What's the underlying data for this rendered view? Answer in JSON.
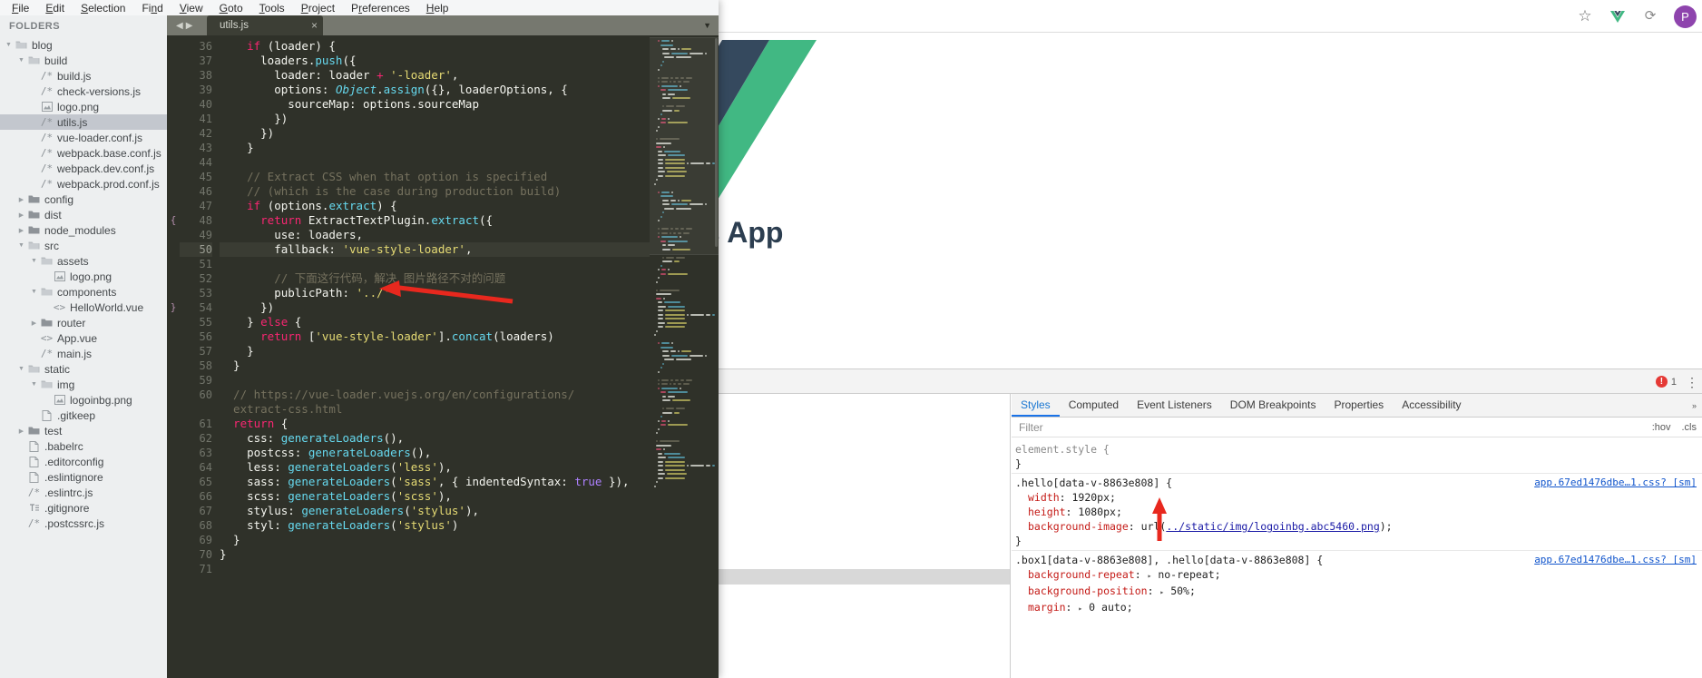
{
  "colors": {
    "accent_blue": "#1a73e8",
    "vue_green": "#41b883",
    "vue_dark": "#35495e",
    "error_red": "#e53935",
    "annotation_red": "#e8281e",
    "editor_bg": "#2f3129",
    "sidebar_bg": "#edeff0",
    "selection_bg": "#c3c7ce"
  },
  "browser": {
    "toolbar_icons": [
      {
        "name": "bookmark-star-icon",
        "glyph": "☆"
      },
      {
        "name": "vue-devtools-icon",
        "glyph": "V"
      },
      {
        "name": "extensions-icon",
        "glyph": "⟳"
      }
    ],
    "profile_initial": "P"
  },
  "webpage": {
    "hero_title": "our Vue.js App"
  },
  "devtools": {
    "error_count": "1",
    "kebab": "⋮",
    "tabs": [
      {
        "label": "Styles",
        "active": true
      },
      {
        "label": "Computed",
        "active": false
      },
      {
        "label": "Event Listeners",
        "active": false
      },
      {
        "label": "DOM Breakpoints",
        "active": false
      },
      {
        "label": "Properties",
        "active": false
      },
      {
        "label": "Accessibility",
        "active": false
      }
    ],
    "overflow_chevron": "»",
    "filter": {
      "value": "",
      "placeholder": "Filter"
    },
    "filter_options": [
      ":hov",
      ".cls"
    ],
    "css_rules": [
      {
        "selector": "element.style {",
        "origin": "",
        "declarations": [],
        "close": "}"
      },
      {
        "selector": ".hello[data-v-8863e808] {",
        "origin": "app.67ed1476dbe…1.css? [sm]",
        "declarations": [
          {
            "prop": "width",
            "value": "1920px;",
            "kind": "plain"
          },
          {
            "prop": "height",
            "value": "1080px;",
            "kind": "plain"
          },
          {
            "prop": "background-image",
            "value": "url(",
            "url": "../static/img/logoinbg.abc5460.png",
            "value_end": ");",
            "kind": "url"
          }
        ],
        "close": "}"
      },
      {
        "selector": ".box1[data-v-8863e808], .hello[data-v-8863e808] {",
        "origin": "app.67ed1476dbe…1.css? [sm]",
        "declarations": [
          {
            "prop": "background-repeat",
            "value": "no-repeat;",
            "kind": "tri"
          },
          {
            "prop": "background-position",
            "value": "50%;",
            "kind": "tri"
          },
          {
            "prop": "margin",
            "value": "0 auto;",
            "kind": "tri"
          }
        ],
        "close": ""
      }
    ]
  },
  "sublime": {
    "menu": [
      {
        "label": "File",
        "mnemonic": "F"
      },
      {
        "label": "Edit",
        "mnemonic": "E"
      },
      {
        "label": "Selection",
        "mnemonic": "S"
      },
      {
        "label": "Find",
        "mnemonic": "n"
      },
      {
        "label": "View",
        "mnemonic": "V"
      },
      {
        "label": "Goto",
        "mnemonic": "G"
      },
      {
        "label": "Tools",
        "mnemonic": "T"
      },
      {
        "label": "Project",
        "mnemonic": "P"
      },
      {
        "label": "Preferences",
        "mnemonic": "r"
      },
      {
        "label": "Help",
        "mnemonic": "H"
      }
    ],
    "sidebar_title": "FOLDERS",
    "tree": [
      {
        "label": "blog",
        "depth": 0,
        "type": "folder-open",
        "arrow": "open",
        "selected": false
      },
      {
        "label": "build",
        "depth": 1,
        "type": "folder-open",
        "arrow": "open",
        "selected": false
      },
      {
        "label": "build.js",
        "depth": 2,
        "type": "js",
        "arrow": "none",
        "selected": false
      },
      {
        "label": "check-versions.js",
        "depth": 2,
        "type": "js",
        "arrow": "none",
        "selected": false
      },
      {
        "label": "logo.png",
        "depth": 2,
        "type": "image",
        "arrow": "none",
        "selected": false
      },
      {
        "label": "utils.js",
        "depth": 2,
        "type": "js",
        "arrow": "none",
        "selected": true
      },
      {
        "label": "vue-loader.conf.js",
        "depth": 2,
        "type": "js",
        "arrow": "none",
        "selected": false
      },
      {
        "label": "webpack.base.conf.js",
        "depth": 2,
        "type": "js",
        "arrow": "none",
        "selected": false
      },
      {
        "label": "webpack.dev.conf.js",
        "depth": 2,
        "type": "js",
        "arrow": "none",
        "selected": false
      },
      {
        "label": "webpack.prod.conf.js",
        "depth": 2,
        "type": "js",
        "arrow": "none",
        "selected": false
      },
      {
        "label": "config",
        "depth": 1,
        "type": "folder",
        "arrow": "closed",
        "selected": false
      },
      {
        "label": "dist",
        "depth": 1,
        "type": "folder",
        "arrow": "closed",
        "selected": false
      },
      {
        "label": "node_modules",
        "depth": 1,
        "type": "folder",
        "arrow": "closed",
        "selected": false
      },
      {
        "label": "src",
        "depth": 1,
        "type": "folder-open",
        "arrow": "open",
        "selected": false
      },
      {
        "label": "assets",
        "depth": 2,
        "type": "folder-open",
        "arrow": "open",
        "selected": false
      },
      {
        "label": "logo.png",
        "depth": 3,
        "type": "image",
        "arrow": "none",
        "selected": false
      },
      {
        "label": "components",
        "depth": 2,
        "type": "folder-open",
        "arrow": "open",
        "selected": false
      },
      {
        "label": "HelloWorld.vue",
        "depth": 3,
        "type": "vue",
        "arrow": "none",
        "selected": false
      },
      {
        "label": "router",
        "depth": 2,
        "type": "folder",
        "arrow": "closed",
        "selected": false
      },
      {
        "label": "App.vue",
        "depth": 2,
        "type": "vue",
        "arrow": "none",
        "selected": false
      },
      {
        "label": "main.js",
        "depth": 2,
        "type": "js",
        "arrow": "none",
        "selected": false
      },
      {
        "label": "static",
        "depth": 1,
        "type": "folder-open",
        "arrow": "open",
        "selected": false
      },
      {
        "label": "img",
        "depth": 2,
        "type": "folder-open",
        "arrow": "open",
        "selected": false
      },
      {
        "label": "logoinbg.png",
        "depth": 3,
        "type": "image",
        "arrow": "none",
        "selected": false
      },
      {
        "label": ".gitkeep",
        "depth": 2,
        "type": "file",
        "arrow": "none",
        "selected": false
      },
      {
        "label": "test",
        "depth": 1,
        "type": "folder",
        "arrow": "closed",
        "selected": false
      },
      {
        "label": ".babelrc",
        "depth": 1,
        "type": "file",
        "arrow": "none",
        "selected": false
      },
      {
        "label": ".editorconfig",
        "depth": 1,
        "type": "file",
        "arrow": "none",
        "selected": false
      },
      {
        "label": ".eslintignore",
        "depth": 1,
        "type": "file",
        "arrow": "none",
        "selected": false
      },
      {
        "label": ".eslintrc.js",
        "depth": 1,
        "type": "js",
        "arrow": "none",
        "selected": false
      },
      {
        "label": ".gitignore",
        "depth": 1,
        "type": "text",
        "arrow": "none",
        "selected": false
      },
      {
        "label": ".postcssrc.js",
        "depth": 1,
        "type": "js",
        "arrow": "none",
        "selected": false
      }
    ],
    "tab": {
      "label": "utils.js",
      "close_glyph": "×"
    },
    "tab_nav": {
      "prev": "◀",
      "next": "▶"
    },
    "tab_menu_glyph": "▼",
    "current_line": 50,
    "fold_markers": [
      {
        "line": 48,
        "glyph": "{"
      },
      {
        "line": 54,
        "glyph": "}"
      }
    ],
    "code": [
      {
        "n": 36,
        "text": "    if (loader) {"
      },
      {
        "n": 37,
        "text": "      loaders.push({"
      },
      {
        "n": 38,
        "text": "        loader: loader + '-loader',"
      },
      {
        "n": 39,
        "text": "        options: Object.assign({}, loaderOptions, {"
      },
      {
        "n": 40,
        "text": "          sourceMap: options.sourceMap"
      },
      {
        "n": 41,
        "text": "        })"
      },
      {
        "n": 42,
        "text": "      })"
      },
      {
        "n": 43,
        "text": "    }"
      },
      {
        "n": 44,
        "text": ""
      },
      {
        "n": 45,
        "text": "    // Extract CSS when that option is specified"
      },
      {
        "n": 46,
        "text": "    // (which is the case during production build)"
      },
      {
        "n": 47,
        "text": "    if (options.extract) {"
      },
      {
        "n": 48,
        "text": "      return ExtractTextPlugin.extract({"
      },
      {
        "n": 49,
        "text": "        use: loaders,"
      },
      {
        "n": 50,
        "text": "        fallback: 'vue-style-loader',"
      },
      {
        "n": 51,
        "text": ""
      },
      {
        "n": 52,
        "text": "        // 下面这行代码，解决 图片路径不对的问题"
      },
      {
        "n": 53,
        "text": "        publicPath: '../'"
      },
      {
        "n": 54,
        "text": "      })"
      },
      {
        "n": 55,
        "text": "    } else {"
      },
      {
        "n": 56,
        "text": "      return ['vue-style-loader'].concat(loaders)"
      },
      {
        "n": 57,
        "text": "    }"
      },
      {
        "n": 58,
        "text": "  }"
      },
      {
        "n": 59,
        "text": ""
      },
      {
        "n": 60,
        "text": "  // https://vue-loader.vuejs.org/en/configurations/"
      },
      {
        "n": "",
        "text": "  extract-css.html"
      },
      {
        "n": 61,
        "text": "  return {"
      },
      {
        "n": 62,
        "text": "    css: generateLoaders(),"
      },
      {
        "n": 63,
        "text": "    postcss: generateLoaders(),"
      },
      {
        "n": 64,
        "text": "    less: generateLoaders('less'),"
      },
      {
        "n": 65,
        "text": "    sass: generateLoaders('sass', { indentedSyntax: true }),"
      },
      {
        "n": 66,
        "text": "    scss: generateLoaders('scss'),"
      },
      {
        "n": 67,
        "text": "    stylus: generateLoaders('stylus'),"
      },
      {
        "n": 68,
        "text": "    styl: generateLoaders('stylus')"
      },
      {
        "n": 69,
        "text": "  }"
      },
      {
        "n": 70,
        "text": "}"
      },
      {
        "n": 71,
        "text": ""
      }
    ]
  },
  "annotations": [
    {
      "name": "arrow-publicpath",
      "points_at": "publicPath: '../'"
    },
    {
      "name": "arrow-background-image-url",
      "points_at": "url(../static/img/logoinbg.abc5460.png)"
    }
  ]
}
